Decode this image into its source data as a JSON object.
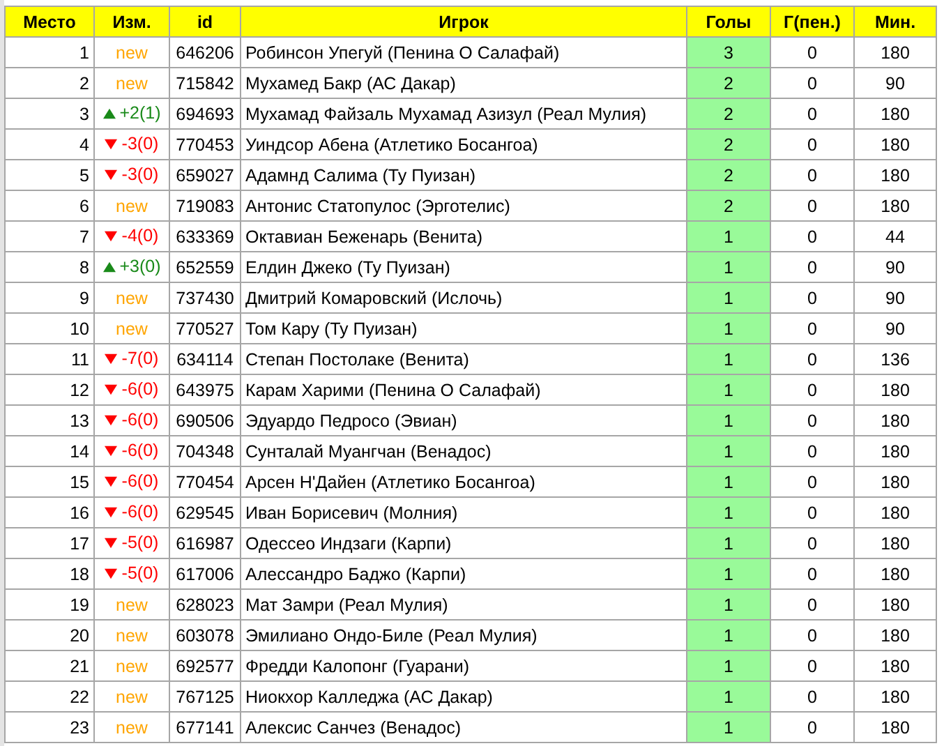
{
  "columns": [
    "Место",
    "Изм.",
    "id",
    "Игрок",
    "Голы",
    "Г(пен.)",
    "Мин."
  ],
  "rows": [
    {
      "place": "1",
      "change": {
        "kind": "new",
        "text": "new"
      },
      "id": "646206",
      "player": "Робинсон Упегуй (Пенина О Салафай)",
      "goals": "3",
      "pen": "0",
      "min": "180"
    },
    {
      "place": "2",
      "change": {
        "kind": "new",
        "text": "new"
      },
      "id": "715842",
      "player": "Мухамед Бакр (АС Дакар)",
      "goals": "2",
      "pen": "0",
      "min": "90"
    },
    {
      "place": "3",
      "change": {
        "kind": "up",
        "text": "+2(1)"
      },
      "id": "694693",
      "player": "Мухамад Файзаль Мухамад Азизул (Реал Мулия)",
      "goals": "2",
      "pen": "0",
      "min": "180"
    },
    {
      "place": "4",
      "change": {
        "kind": "down",
        "text": "-3(0)"
      },
      "id": "770453",
      "player": "Уиндсор Абена (Атлетико Босангоа)",
      "goals": "2",
      "pen": "0",
      "min": "180"
    },
    {
      "place": "5",
      "change": {
        "kind": "down",
        "text": "-3(0)"
      },
      "id": "659027",
      "player": "Адамнд Салима (Ту Пуизан)",
      "goals": "2",
      "pen": "0",
      "min": "180"
    },
    {
      "place": "6",
      "change": {
        "kind": "new",
        "text": "new"
      },
      "id": "719083",
      "player": "Антонис Статопулос (Эрготелис)",
      "goals": "2",
      "pen": "0",
      "min": "180"
    },
    {
      "place": "7",
      "change": {
        "kind": "down",
        "text": "-4(0)"
      },
      "id": "633369",
      "player": "Октавиан Беженарь (Венита)",
      "goals": "1",
      "pen": "0",
      "min": "44"
    },
    {
      "place": "8",
      "change": {
        "kind": "up",
        "text": "+3(0)"
      },
      "id": "652559",
      "player": "Елдин Джеко (Ту Пуизан)",
      "goals": "1",
      "pen": "0",
      "min": "90"
    },
    {
      "place": "9",
      "change": {
        "kind": "new",
        "text": "new"
      },
      "id": "737430",
      "player": "Дмитрий Комаровский (Ислочь)",
      "goals": "1",
      "pen": "0",
      "min": "90"
    },
    {
      "place": "10",
      "change": {
        "kind": "new",
        "text": "new"
      },
      "id": "770527",
      "player": "Том Кару (Ту Пуизан)",
      "goals": "1",
      "pen": "0",
      "min": "90"
    },
    {
      "place": "11",
      "change": {
        "kind": "down",
        "text": "-7(0)"
      },
      "id": "634114",
      "player": "Степан Постолаке (Венита)",
      "goals": "1",
      "pen": "0",
      "min": "136"
    },
    {
      "place": "12",
      "change": {
        "kind": "down",
        "text": "-6(0)"
      },
      "id": "643975",
      "player": "Карам Харими (Пенина О Салафай)",
      "goals": "1",
      "pen": "0",
      "min": "180"
    },
    {
      "place": "13",
      "change": {
        "kind": "down",
        "text": "-6(0)"
      },
      "id": "690506",
      "player": "Эдуардо Педросо (Эвиан)",
      "goals": "1",
      "pen": "0",
      "min": "180"
    },
    {
      "place": "14",
      "change": {
        "kind": "down",
        "text": "-6(0)"
      },
      "id": "704348",
      "player": "Сунталай Муангчан (Венадос)",
      "goals": "1",
      "pen": "0",
      "min": "180"
    },
    {
      "place": "15",
      "change": {
        "kind": "down",
        "text": "-6(0)"
      },
      "id": "770454",
      "player": "Арсен Н'Дайен (Атлетико Босангоа)",
      "goals": "1",
      "pen": "0",
      "min": "180"
    },
    {
      "place": "16",
      "change": {
        "kind": "down",
        "text": "-6(0)"
      },
      "id": "629545",
      "player": "Иван Борисевич (Молния)",
      "goals": "1",
      "pen": "0",
      "min": "180"
    },
    {
      "place": "17",
      "change": {
        "kind": "down",
        "text": "-5(0)"
      },
      "id": "616987",
      "player": "Одессео Индзаги (Карпи)",
      "goals": "1",
      "pen": "0",
      "min": "180"
    },
    {
      "place": "18",
      "change": {
        "kind": "down",
        "text": "-5(0)"
      },
      "id": "617006",
      "player": "Алессандро Баджо (Карпи)",
      "goals": "1",
      "pen": "0",
      "min": "180"
    },
    {
      "place": "19",
      "change": {
        "kind": "new",
        "text": "new"
      },
      "id": "628023",
      "player": "Мат Замри (Реал Мулия)",
      "goals": "1",
      "pen": "0",
      "min": "180"
    },
    {
      "place": "20",
      "change": {
        "kind": "new",
        "text": "new"
      },
      "id": "603078",
      "player": "Эмилиано Ондо-Биле (Реал Мулия)",
      "goals": "1",
      "pen": "0",
      "min": "180"
    },
    {
      "place": "21",
      "change": {
        "kind": "new",
        "text": "new"
      },
      "id": "692577",
      "player": "Фредди Калопонг (Гуарани)",
      "goals": "1",
      "pen": "0",
      "min": "180"
    },
    {
      "place": "22",
      "change": {
        "kind": "new",
        "text": "new"
      },
      "id": "767125",
      "player": "Ниокхор Калледжа (АС Дакар)",
      "goals": "1",
      "pen": "0",
      "min": "180"
    },
    {
      "place": "23",
      "change": {
        "kind": "new",
        "text": "new"
      },
      "id": "677141",
      "player": "Алексис Санчез (Венадос)",
      "goals": "1",
      "pen": "0",
      "min": "180"
    }
  ]
}
